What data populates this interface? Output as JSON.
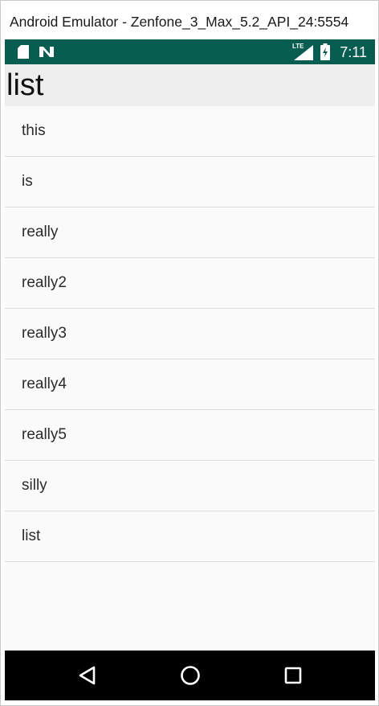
{
  "window": {
    "title": "Android Emulator - Zenfone_3_Max_5.2_API_24:5554"
  },
  "statusbar": {
    "background": "#075e50",
    "time": "7:11",
    "left_icons": [
      "sd-card-icon",
      "notification-n-icon"
    ],
    "right_icons": [
      "lte-signal-icon",
      "battery-icon"
    ],
    "network_label": "LTE"
  },
  "appbar": {
    "title": "list"
  },
  "list": {
    "items": [
      {
        "label": "this"
      },
      {
        "label": "is"
      },
      {
        "label": "really"
      },
      {
        "label": "really2"
      },
      {
        "label": "really3"
      },
      {
        "label": "really4"
      },
      {
        "label": "really5"
      },
      {
        "label": "silly"
      },
      {
        "label": "list"
      }
    ]
  },
  "navbar": {
    "buttons": [
      "back-icon",
      "home-icon",
      "recents-icon"
    ]
  }
}
